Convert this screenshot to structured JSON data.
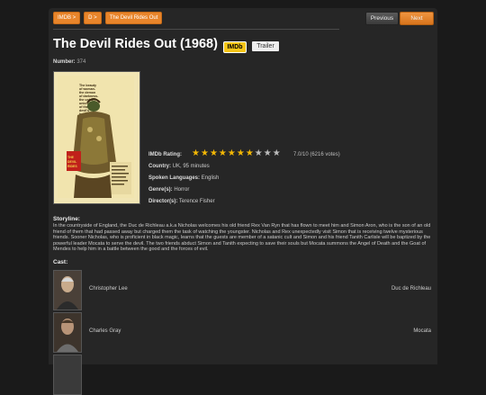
{
  "breadcrumbs": [
    "IMDB >",
    "D >",
    "The Devil Rides Out"
  ],
  "nav": {
    "prev_label": "Previous",
    "next_label": "Next"
  },
  "movie": {
    "title": "The Devil Rides Out (1968)",
    "imdb_badge": "IMDb",
    "trailer_label": "Trailer",
    "number_label": "Number:",
    "number": "374",
    "rating_label": "IMDb Rating:",
    "rating_text": "7.0/10 (6216 votes)",
    "rating_stars_filled": 7,
    "rating_stars_total": 10,
    "country_label": "Country:",
    "country": "UK, 95 minutes",
    "languages_label": "Spoken Languages:",
    "languages": "English",
    "genres_label": "Genre(s):",
    "genres": "Horror",
    "directors_label": "Director(s):",
    "directors": "Terence Fisher"
  },
  "poster": {
    "tagline": "The beauty of woman- the demon of darkness- the unholy union of the devil's bride"
  },
  "storyline": {
    "heading": "Storyline:",
    "text": "In the countryside of England, the Duc de Richleau a.k.a Nicholas welcomes his old friend Rex Van Ryn that has flown to meet him and Simon Aron, who is the son of an old friend of them that had passed away but charged them the task of watching the youngster. Nicholas and Rex unexpectedly visit Simon that is receiving twelve mysterious friends. Sooner Nicholas, who is proficient in black magic, learns that the guests are member of a satanic cult and Simon and his friend Tanith Carlisle will be baptized by the powerful leader Mocata to serve the devil. The two friends abduct Simon and Tanith expecting to save their souls but Mocata summons the Angel of Death and the Goat of Mendes to help him in a battle between the good and the forces of evil."
  },
  "cast": {
    "heading": "Cast:",
    "members": [
      {
        "name": "Christopher Lee",
        "role": "Duc de Richleau"
      },
      {
        "name": "Charles Gray",
        "role": "Mocata"
      }
    ]
  },
  "colors": {
    "accent": "#e8852b",
    "imdb": "#f5c518",
    "star": "#f2b705"
  }
}
